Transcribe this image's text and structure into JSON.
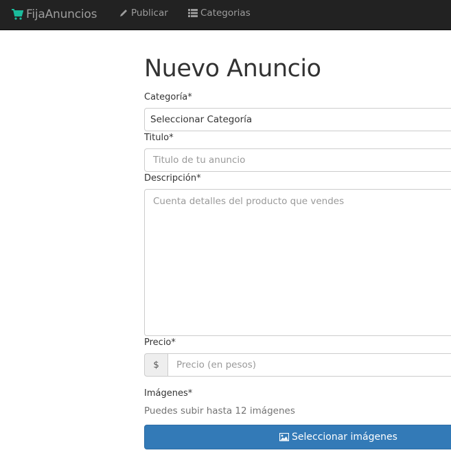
{
  "navbar": {
    "brand": "FijaAnuncios",
    "brand_icon": "shopping-cart-icon",
    "brand_icon_color": "#1abc9c",
    "links": [
      {
        "label": "Publicar",
        "icon": "pencil-icon"
      },
      {
        "label": "Categorias",
        "icon": "list-icon"
      }
    ]
  },
  "form": {
    "title": "Nuevo Anuncio",
    "required_mark": "*",
    "categoria": {
      "label": "Categoría",
      "value": "Seleccionar Categoría"
    },
    "titulo": {
      "label": "Titulo",
      "placeholder": "Titulo de tu anuncio"
    },
    "descripcion": {
      "label": "Descripción",
      "placeholder": "Cuenta detalles del producto que vendes"
    },
    "precio": {
      "label": "Precio",
      "addon": "$",
      "placeholder": "Precio (en pesos)"
    },
    "imagenes": {
      "label": "Imágenes",
      "help": "Puedes subir hasta 12 imágenes",
      "button_label": "Seleccionar imágenes",
      "button_icon": "image-icon",
      "button_color": "#337ab7"
    }
  }
}
